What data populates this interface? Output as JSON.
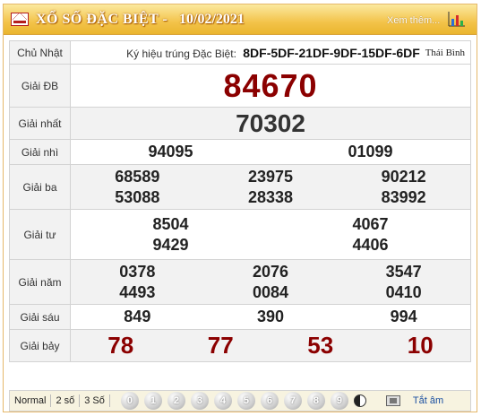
{
  "header": {
    "title": "XỔ SỐ ĐẶC BIỆT -",
    "date": "10/02/2021",
    "more_link": "Xem thêm...",
    "icons": [
      "mail-icon",
      "bar-chart-icon"
    ]
  },
  "top_row": {
    "day": "Chủ Nhật",
    "kyhieu_label": "Ký hiệu trúng Đặc Biệt:",
    "kyhieu_code": "8DF-5DF-21DF-9DF-15DF-6DF",
    "province": "Thái Bình"
  },
  "prizes": {
    "db": {
      "label": "Giải ĐB",
      "numbers": [
        "84670"
      ]
    },
    "nhat": {
      "label": "Giải nhất",
      "numbers": [
        "70302"
      ]
    },
    "nhi": {
      "label": "Giải nhì",
      "numbers": [
        "94095",
        "01099"
      ]
    },
    "ba": {
      "label": "Giải ba",
      "numbers": [
        "68589",
        "23975",
        "90212",
        "53088",
        "28338",
        "83992"
      ]
    },
    "tu": {
      "label": "Giải tư",
      "numbers": [
        "8504",
        "4067",
        "9429",
        "4406"
      ]
    },
    "nam": {
      "label": "Giải năm",
      "numbers": [
        "0378",
        "2076",
        "3547",
        "4493",
        "0084",
        "0410"
      ]
    },
    "sau": {
      "label": "Giải sáu",
      "numbers": [
        "849",
        "390",
        "994"
      ]
    },
    "bay": {
      "label": "Giải bảy",
      "numbers": [
        "78",
        "77",
        "53",
        "10"
      ]
    }
  },
  "footer": {
    "modes": [
      "Normal",
      "2 số",
      "3 Số"
    ],
    "digits": [
      "0",
      "1",
      "2",
      "3",
      "4",
      "5",
      "6",
      "7",
      "8",
      "9"
    ],
    "sound_toggle_label": "Tắt âm"
  },
  "colors": {
    "header_bg": "#f3c34a",
    "prize_red": "#8b0000",
    "row_alt": "#f2f2f2"
  }
}
